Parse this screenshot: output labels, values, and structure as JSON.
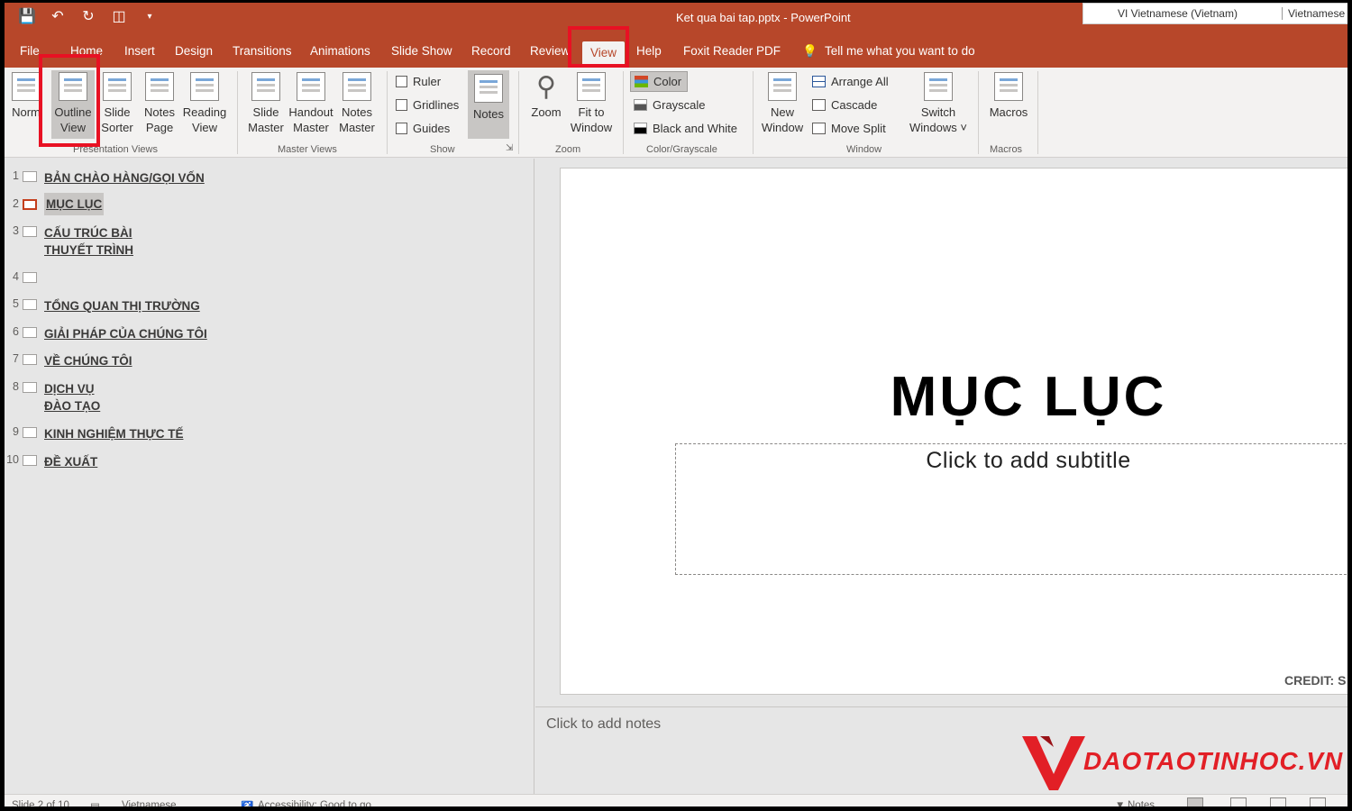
{
  "titlebar": {
    "title": "Ket qua bai tap.pptx  -  PowerPoint",
    "qat": [
      "save-icon",
      "undo-icon",
      "redo-icon",
      "present-icon",
      "customize-icon"
    ],
    "lang_primary": "VI  Vietnamese (Vietnam)",
    "lang_secondary": "Vietnamese"
  },
  "tabs": {
    "file": "File",
    "home": "Home",
    "insert": "Insert",
    "design": "Design",
    "transitions": "Transitions",
    "animations": "Animations",
    "slideshow": "Slide Show",
    "record": "Record",
    "review": "Review",
    "view": "View",
    "help": "Help",
    "foxit": "Foxit Reader PDF",
    "tellme": "Tell me what you want to do"
  },
  "ribbon": {
    "presentation_views": {
      "label": "Presentation Views",
      "normal": "Norm",
      "outline_1": "Outline",
      "outline_2": "View",
      "sorter_1": "Slide",
      "sorter_2": "Sorter",
      "notes_page_1": "Notes",
      "notes_page_2": "Page",
      "reading_1": "Reading",
      "reading_2": "View"
    },
    "master_views": {
      "label": "Master Views",
      "slide_1": "Slide",
      "slide_2": "Master",
      "handout_1": "Handout",
      "handout_2": "Master",
      "notes_1": "Notes",
      "notes_2": "Master"
    },
    "show": {
      "label": "Show",
      "ruler": "Ruler",
      "gridlines": "Gridlines",
      "guides": "Guides",
      "notes": "Notes"
    },
    "zoom": {
      "label": "Zoom",
      "zoom": "Zoom",
      "fit_1": "Fit to",
      "fit_2": "Window"
    },
    "color": {
      "label": "Color/Grayscale",
      "color": "Color",
      "grayscale": "Grayscale",
      "bw": "Black and White"
    },
    "window": {
      "label": "Window",
      "new_1": "New",
      "new_2": "Window",
      "arrange": "Arrange All",
      "cascade": "Cascade",
      "split": "Move Split",
      "switch_1": "Switch",
      "switch_2": "Windows ˅"
    },
    "macros": {
      "label": "Macros",
      "macros": "Macros"
    }
  },
  "outline": [
    {
      "num": "1",
      "lines": [
        "BẢN CHÀO HÀNG/GỌI VỐN"
      ]
    },
    {
      "num": "2",
      "lines": [
        "MỤC LỤC"
      ]
    },
    {
      "num": "3",
      "lines": [
        "CẤU TRÚC BÀI",
        "THUYẾT TRÌNH"
      ]
    },
    {
      "num": "4",
      "lines": [
        ""
      ]
    },
    {
      "num": "5",
      "lines": [
        "TỔNG QUAN THỊ TRƯỜNG"
      ]
    },
    {
      "num": "6",
      "lines": [
        "GIẢI PHÁP CỦA CHÚNG TÔI"
      ]
    },
    {
      "num": "7",
      "lines": [
        "VỀ CHÚNG TÔI"
      ]
    },
    {
      "num": "8",
      "lines": [
        "DỊCH VỤ",
        "ĐÀO TẠO"
      ]
    },
    {
      "num": "9",
      "lines": [
        "KINH NGHIỆM THỰC TẾ"
      ]
    },
    {
      "num": "10",
      "lines": [
        "ĐỀ XUẤT"
      ]
    }
  ],
  "slide": {
    "title": "MỤC LỤC",
    "subtitle_placeholder": "Click to add subtitle",
    "credit": "CREDIT: S"
  },
  "notes": {
    "placeholder": "Click to add notes"
  },
  "watermark": {
    "text": "DAOTAOTINHOC.VN"
  },
  "status": {
    "slide": "Slide 2 of 10",
    "language": "Vietnamese",
    "accessibility": "Accessibility: Good to go",
    "notes": "Notes"
  },
  "colors": {
    "accent": "#b7472a",
    "highlight_box": "#e81123",
    "ribbon_bg": "#f3f2f1"
  }
}
